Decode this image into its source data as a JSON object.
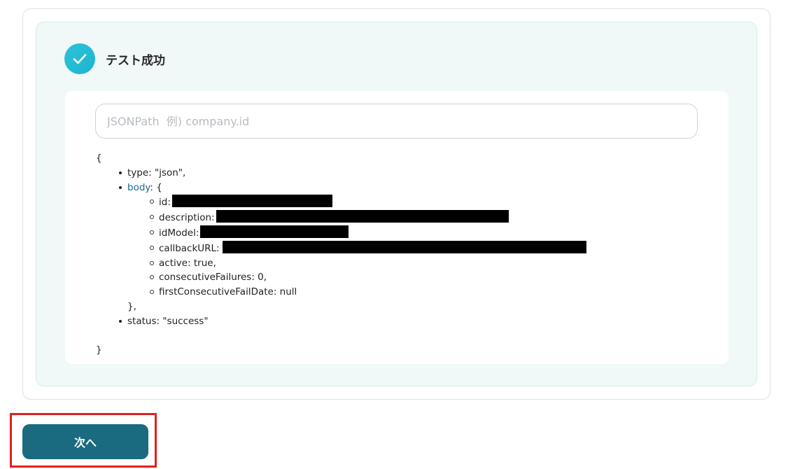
{
  "status": {
    "text": "テスト成功",
    "icon": "check-icon",
    "color": "#22bdd6"
  },
  "jsonpath": {
    "placeholder": "JSONPath  例) company.id",
    "value": ""
  },
  "json": {
    "open": "{",
    "close": "}",
    "type_line": "type: \"json\",",
    "body_key": "body",
    "body_open": ": {",
    "body_close": "},",
    "fields": {
      "id": "id:",
      "description": "description:",
      "idModel": "idModel:",
      "callbackURL": "callbackURL:",
      "active": "active: true,",
      "consecutiveFailures": "consecutiveFailures: 0,",
      "firstConsecutiveFailDate": "firstConsecutiveFailDate: null"
    },
    "status_line": "status: \"success\""
  },
  "next_button": {
    "label": "次へ",
    "color": "#1a6a80"
  },
  "highlight_color": "#e02020"
}
